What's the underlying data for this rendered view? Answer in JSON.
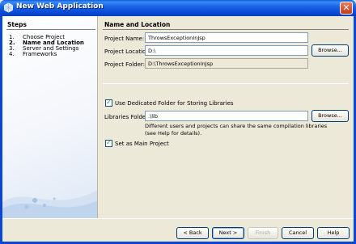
{
  "window": {
    "title": "New Web Application"
  },
  "steps": {
    "heading": "Steps",
    "items": [
      {
        "num": "1.",
        "label": "Choose Project"
      },
      {
        "num": "2.",
        "label": "Name and Location"
      },
      {
        "num": "3.",
        "label": "Server and Settings"
      },
      {
        "num": "4.",
        "label": "Frameworks"
      }
    ],
    "current_index": 1
  },
  "panel": {
    "title": "Name and Location",
    "project_name_label": "Project Name:",
    "project_name_value": "ThrowsExceptionInJsp",
    "project_location_label": "Project Location:",
    "project_location_value": "D:\\",
    "browse_label": "Browse...",
    "project_folder_label": "Project Folder:",
    "project_folder_value": "D:\\ThrowsExceptionInJsp",
    "dedicated_folder_label": "Use Dedicated Folder for Storing Libraries",
    "dedicated_folder_checked": true,
    "libraries_folder_label": "Libraries Folder:",
    "libraries_folder_value": ".\\lib",
    "help_line1": "Different users and projects can share the same compilation libraries",
    "help_line2": "(see Help for details).",
    "main_project_label": "Set as Main Project",
    "main_project_checked": true
  },
  "footer": {
    "back": "< Back",
    "next": "Next >",
    "finish": "Finish",
    "cancel": "Cancel",
    "help": "Help"
  }
}
